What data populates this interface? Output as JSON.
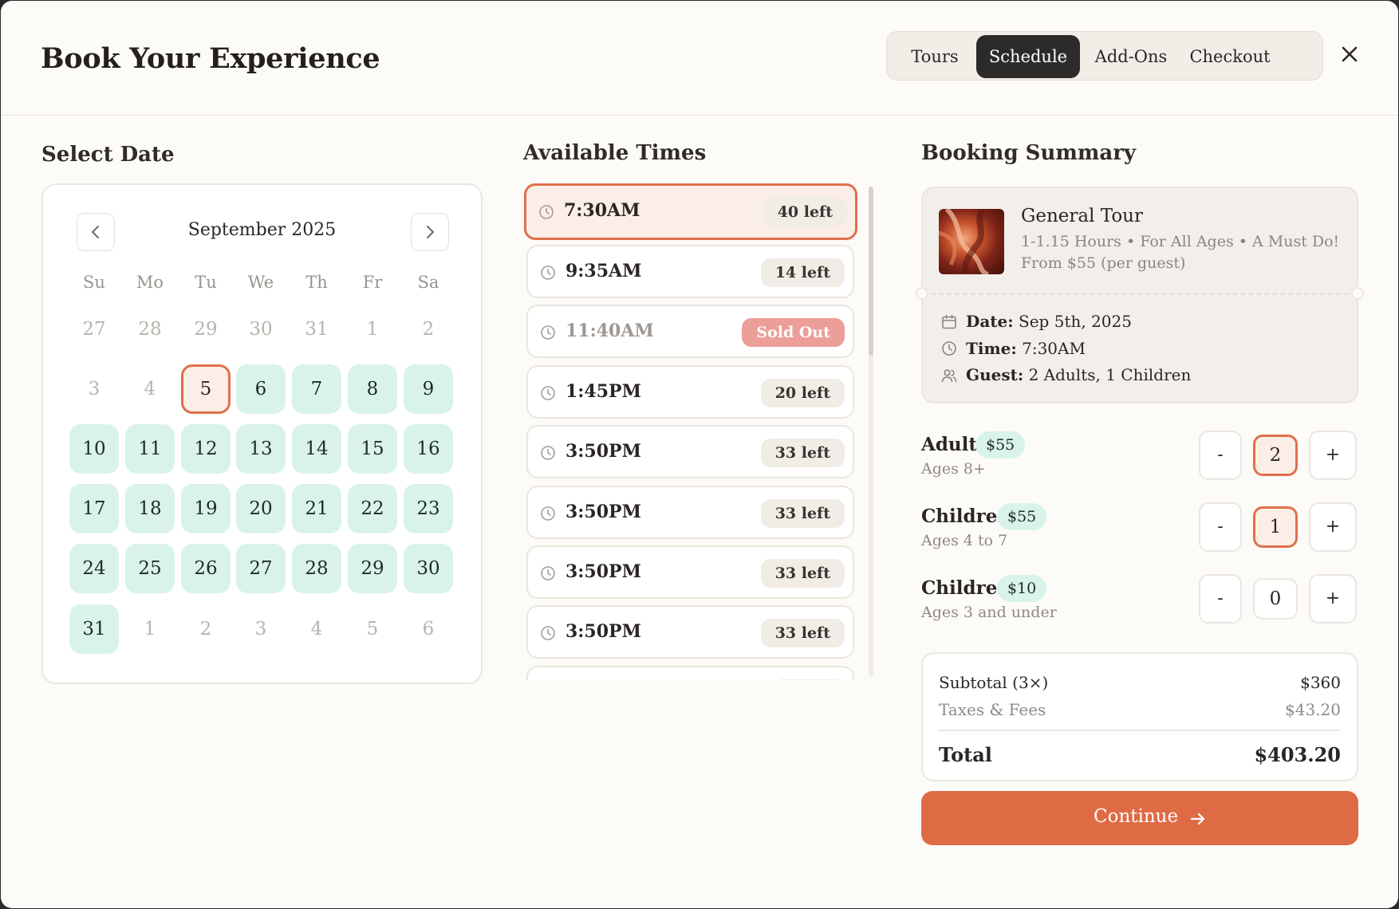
{
  "header": {
    "title": "Book Your Experience",
    "steps": [
      "Tours",
      "Schedule",
      "Add-Ons",
      "Checkout"
    ],
    "active_step": "Schedule"
  },
  "calendar": {
    "section_title": "Select Date",
    "month": "September 2025",
    "weekdays": [
      "Su",
      "Mo",
      "Tu",
      "We",
      "Th",
      "Fr",
      "Sa"
    ],
    "weeks": [
      [
        "27",
        "28",
        "29",
        "30",
        "31",
        "1",
        "2"
      ],
      [
        "3",
        "4",
        "5",
        "6",
        "7",
        "8",
        "9"
      ],
      [
        "10",
        "11",
        "12",
        "13",
        "14",
        "15",
        "16"
      ],
      [
        "17",
        "18",
        "19",
        "20",
        "21",
        "22",
        "23"
      ],
      [
        "24",
        "25",
        "26",
        "27",
        "28",
        "29",
        "30"
      ],
      [
        "31",
        "1",
        "2",
        "3",
        "4",
        "5",
        "6"
      ]
    ],
    "states": [
      [
        "muted",
        "muted",
        "muted",
        "muted",
        "muted",
        "muted",
        "muted"
      ],
      [
        "muted",
        "muted",
        "selected",
        "avail",
        "avail",
        "avail",
        "avail"
      ],
      [
        "avail",
        "avail",
        "avail",
        "avail",
        "avail",
        "avail",
        "avail"
      ],
      [
        "avail",
        "avail",
        "avail",
        "avail",
        "avail",
        "avail",
        "avail"
      ],
      [
        "avail",
        "avail",
        "avail",
        "avail",
        "avail",
        "avail",
        "avail"
      ],
      [
        "avail",
        "muted",
        "muted",
        "muted",
        "muted",
        "muted",
        "muted"
      ]
    ],
    "selected_date": "5"
  },
  "times": {
    "section_title": "Available Times",
    "slots": [
      {
        "time": "7:30AM",
        "badge": "40 left",
        "state": "active"
      },
      {
        "time": "9:35AM",
        "badge": "14 left",
        "state": "normal"
      },
      {
        "time": "11:40AM",
        "badge": "Sold Out",
        "state": "sold"
      },
      {
        "time": "1:45PM",
        "badge": "20 left",
        "state": "normal"
      },
      {
        "time": "3:50PM",
        "badge": "33 left",
        "state": "normal"
      },
      {
        "time": "3:50PM",
        "badge": "33 left",
        "state": "normal"
      },
      {
        "time": "3:50PM",
        "badge": "33 left",
        "state": "normal"
      },
      {
        "time": "3:50PM",
        "badge": "33 left",
        "state": "normal"
      },
      {
        "time": "",
        "badge": "",
        "state": "normal"
      }
    ]
  },
  "summary": {
    "section_title": "Booking Summary",
    "tour": {
      "name": "General Tour",
      "subtitle": "1-1.15 Hours • For All Ages • A Must Do!",
      "price_line": "From $55 (per guest)"
    },
    "details": {
      "date_label": "Date:",
      "date_value": "Sep 5th, 2025",
      "time_label": "Time:",
      "time_value": "7:30AM",
      "guest_label": "Guest:",
      "guest_value": "2 Adults, 1 Children"
    },
    "tickets": [
      {
        "name": "Adult",
        "price": "$55",
        "ages": "Ages 8+",
        "qty": "2",
        "highlight": true
      },
      {
        "name": "Children",
        "price": "$55",
        "ages": "Ages 4 to 7",
        "qty": "1",
        "highlight": true
      },
      {
        "name": "Children",
        "price": "$10",
        "ages": "Ages 3 and under",
        "qty": "0",
        "highlight": false
      }
    ],
    "qty_minus": "-",
    "qty_plus": "+",
    "totals": {
      "subtotal_label": "Subtotal (3×)",
      "subtotal_value": "$360",
      "taxes_label": "Taxes & Fees",
      "taxes_value": "$43.20",
      "total_label": "Total",
      "total_value": "$403.20"
    },
    "continue_label": "Continue"
  },
  "colors": {
    "accent": "#df6b45",
    "available_day": "#d9f3ea",
    "sold_out": "#ec9e98",
    "background": "#fdfbf7"
  },
  "icons": [
    "close-icon",
    "chevron-left-icon",
    "chevron-right-icon",
    "clock-icon",
    "calendar-icon",
    "users-icon",
    "arrow-right-icon"
  ]
}
